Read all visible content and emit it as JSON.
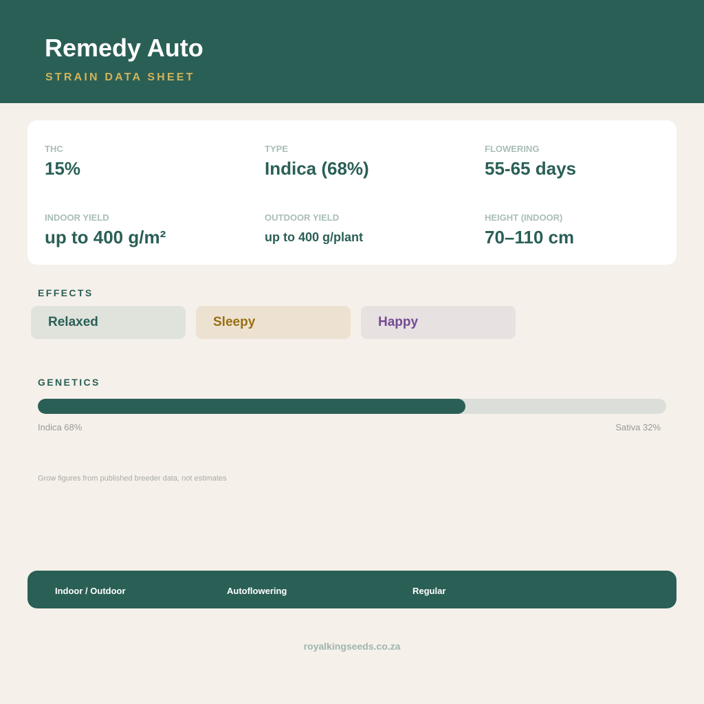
{
  "header": {
    "title": "Remedy Auto",
    "subtitle": "STRAIN DATA SHEET"
  },
  "stats": [
    {
      "label": "THC",
      "value": "15%"
    },
    {
      "label": "TYPE",
      "value": "Indica (68%)"
    },
    {
      "label": "FLOWERING",
      "value": "55-65 days"
    },
    {
      "label": "INDOOR YIELD",
      "value": "up to 400 g/m²"
    },
    {
      "label": "OUTDOOR YIELD",
      "value": "up to 400 g/plant"
    },
    {
      "label": "HEIGHT (INDOOR)",
      "value": "70–110 cm"
    }
  ],
  "effects": {
    "title": "EFFECTS",
    "items": [
      {
        "label": "Relaxed",
        "bg": "#e0e2dc",
        "color": "#2a5f56"
      },
      {
        "label": "Sleepy",
        "bg": "#ede2d2",
        "color": "#9a6f12"
      },
      {
        "label": "Happy",
        "bg": "#e7e1e1",
        "color": "#744b94"
      }
    ]
  },
  "genetics": {
    "title": "GENETICS",
    "indica_percent": 68,
    "indica_label": "Indica 68%",
    "sativa_label": "Sativa 32%"
  },
  "note": "Grow figures from published breeder data, not estimates",
  "footer": {
    "items": [
      "Indoor / Outdoor",
      "Autoflowering",
      "Regular"
    ],
    "website": "royalkingseeds.co.za"
  },
  "colors": {
    "primary": "#2a5f56",
    "accent": "#d3b35a",
    "background": "#f5f0ea"
  }
}
